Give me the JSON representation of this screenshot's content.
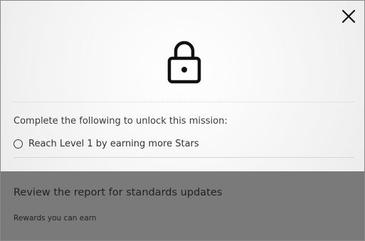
{
  "dialog": {
    "close_icon": "close-icon",
    "lock_icon": "lock-icon",
    "unlock_prompt": "Complete the following to unlock this mission:",
    "requirements": [
      {
        "label": "Reach Level 1 by earning more Stars",
        "completed": false
      }
    ]
  },
  "mission": {
    "title": "Review the report for standards updates",
    "rewards_label": "Rewards you can earn"
  },
  "colors": {
    "overlay": "#7a7a7a",
    "text": "#333333"
  }
}
